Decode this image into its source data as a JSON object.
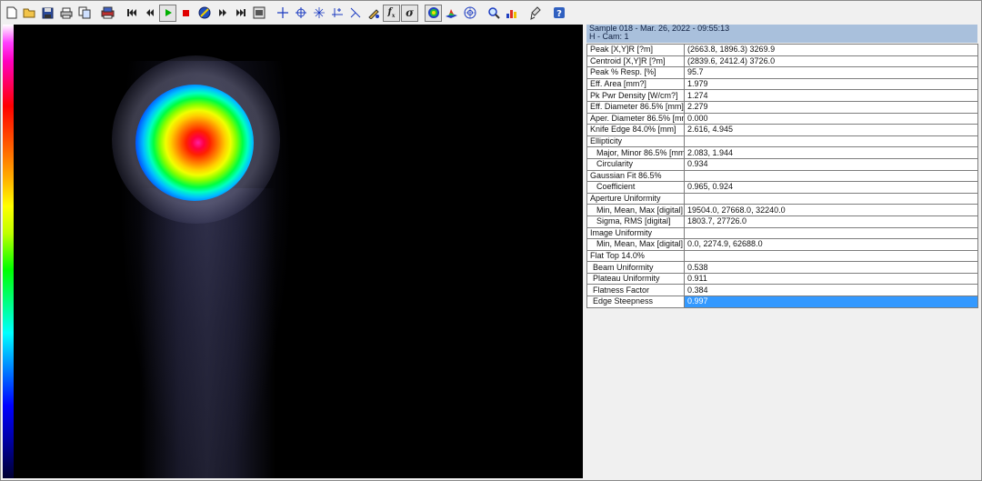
{
  "toolbar": {
    "buttons": [
      {
        "name": "new-file-icon",
        "glyph": "🗋"
      },
      {
        "name": "open-folder-icon",
        "glyph": "📂"
      },
      {
        "name": "save-icon",
        "glyph": "💾"
      },
      {
        "name": "print-icon",
        "glyph": "🖶"
      },
      {
        "name": "copy-icon",
        "glyph": "⧉"
      },
      {
        "name": "capture-icon",
        "glyph": "▦"
      },
      {
        "name": "skip-first-icon",
        "glyph": "⏮"
      },
      {
        "name": "step-back-icon",
        "glyph": "⏪"
      },
      {
        "name": "play-icon",
        "glyph": "▶"
      },
      {
        "name": "stop-icon",
        "glyph": "■"
      },
      {
        "name": "no-entry-icon",
        "glyph": "⊘"
      },
      {
        "name": "step-forward-icon",
        "glyph": "⏩"
      },
      {
        "name": "skip-last-icon",
        "glyph": "⏭"
      },
      {
        "name": "camera-calc-icon",
        "glyph": "▣"
      },
      {
        "name": "crosshair-icon",
        "glyph": "+"
      },
      {
        "name": "centroid-icon",
        "glyph": "⊕"
      },
      {
        "name": "axis-rotate-icon",
        "glyph": "⋇"
      },
      {
        "name": "cursor-icon",
        "glyph": "⊹"
      },
      {
        "name": "line-profile-icon",
        "glyph": "⤡"
      },
      {
        "name": "drawing-icon",
        "glyph": "✎"
      },
      {
        "name": "function-icon",
        "glyph": "fx"
      },
      {
        "name": "sigma-icon",
        "glyph": "σ"
      },
      {
        "name": "2d-view-icon",
        "glyph": "◉"
      },
      {
        "name": "3d-view-icon",
        "glyph": "◭"
      },
      {
        "name": "aperture-icon",
        "glyph": "⊛"
      },
      {
        "name": "zoom-icon",
        "glyph": "🔍"
      },
      {
        "name": "palette-icon",
        "glyph": "▥"
      },
      {
        "name": "probe-icon",
        "glyph": "✍"
      },
      {
        "name": "help-icon",
        "glyph": "?"
      }
    ]
  },
  "panel": {
    "header_line1": "Sample  018  -  Mar. 26, 2022  -  09:55:13",
    "header_line2": "H  -  Cam:  1",
    "rows": [
      {
        "label": "Peak [X,Y]R [?m]",
        "value": "(2663.8, 1896.3) 3269.9"
      },
      {
        "label": "Centroid [X,Y]R [?m]",
        "value": "(2839.6, 2412.4) 3726.0"
      },
      {
        "label": "Peak % Resp. [%]",
        "value": "95.7"
      },
      {
        "label": "Eff. Area [mm?]",
        "value": "1.979"
      },
      {
        "label": "Pk Pwr Density [W/cm?]",
        "value": "1.274"
      },
      {
        "label": "Eff. Diameter 86.5% [mm]",
        "value": "2.279"
      },
      {
        "label": "Aper. Diameter 86.5% [mm]",
        "value": "0.000"
      },
      {
        "label": "Knife Edge 84.0% [mm]",
        "value": "2.616, 4.945"
      },
      {
        "label": "Ellipticity",
        "value": ""
      },
      {
        "label": "Major, Minor 86.5% [mm]",
        "value": "2.083, 1.944"
      },
      {
        "label": "Circularity",
        "value": "0.934"
      },
      {
        "label": "Gaussian Fit 86.5%",
        "value": ""
      },
      {
        "label": "Coefficient",
        "value": "0.965, 0.924"
      },
      {
        "label": "Aperture Uniformity",
        "value": ""
      },
      {
        "label": "Min, Mean, Max [digital]",
        "value": "19504.0, 27668.0, 32240.0"
      },
      {
        "label": "Sigma, RMS [digital]",
        "value": "1803.7, 27726.0"
      },
      {
        "label": "Image Uniformity",
        "value": ""
      },
      {
        "label": "Min, Mean, Max [digital]",
        "value": "0.0, 2274.9, 62688.0"
      },
      {
        "label": "Flat Top 14.0%",
        "value": ""
      },
      {
        "label": "Beam Uniformity",
        "value": "0.538"
      },
      {
        "label": "Plateau Uniformity",
        "value": "0.911"
      },
      {
        "label": "Flatness Factor",
        "value": "0.384"
      },
      {
        "label": "Edge Steepness",
        "value": "0.997"
      }
    ]
  },
  "colors": {
    "header_bg": "#a9c0dc",
    "selection": "#3399ff"
  }
}
